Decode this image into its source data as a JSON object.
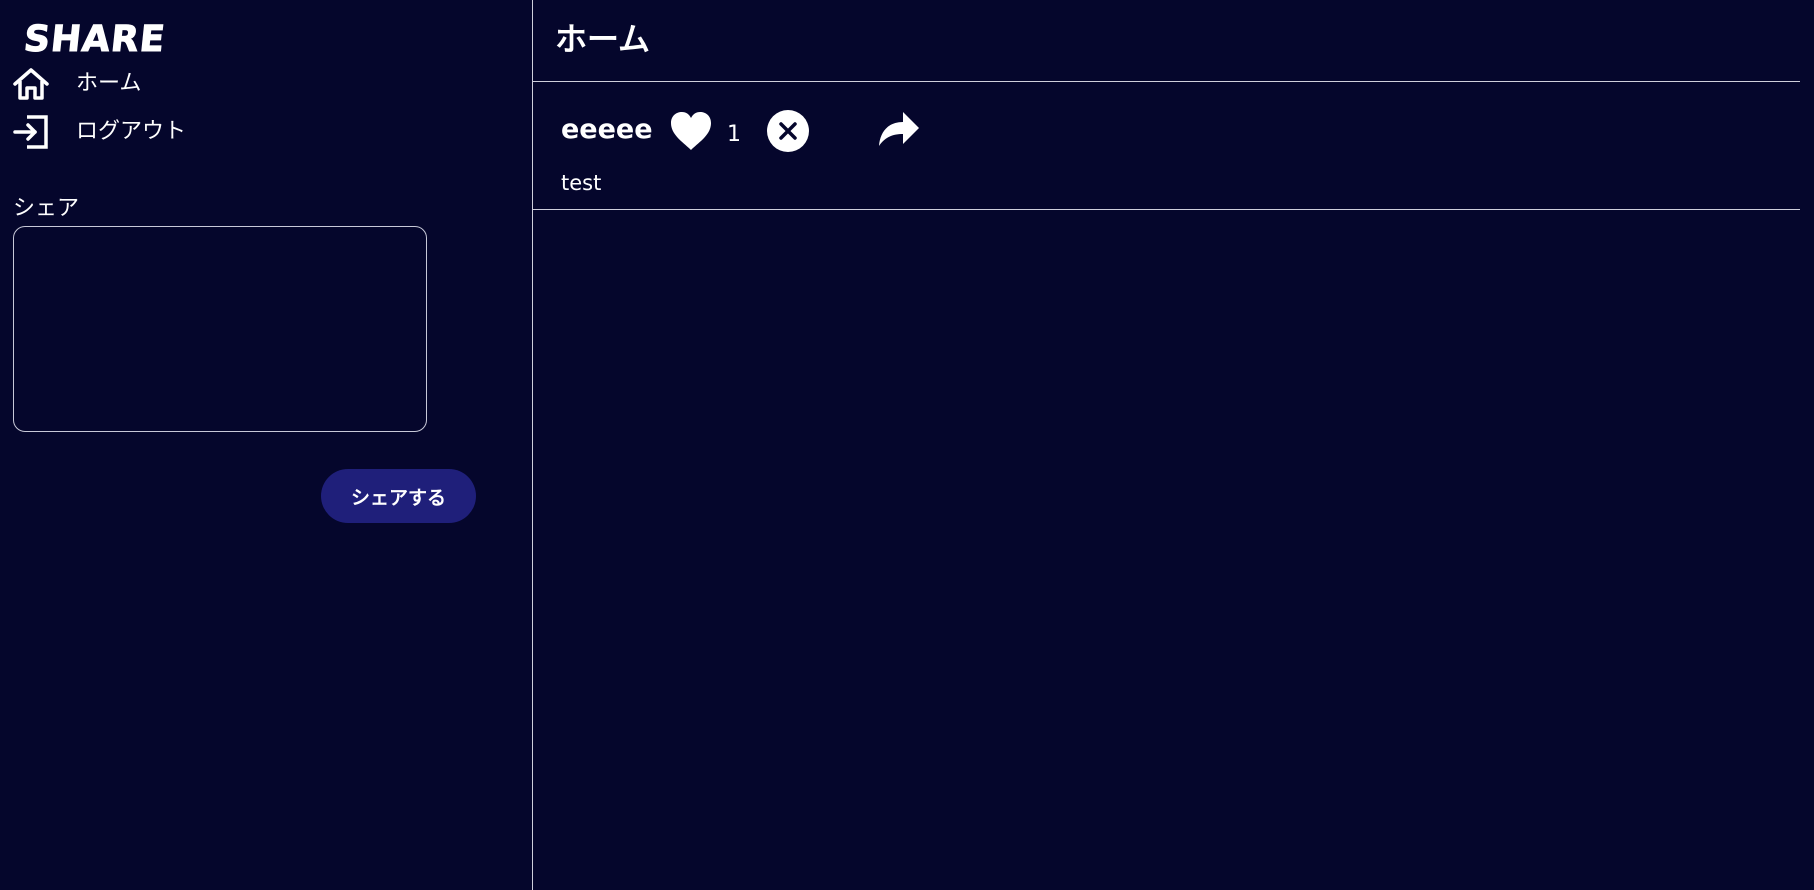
{
  "app": {
    "logo": "SHARE"
  },
  "sidebar": {
    "nav": [
      {
        "label": "ホーム",
        "icon": "home-icon"
      },
      {
        "label": "ログアウト",
        "icon": "logout-icon"
      }
    ],
    "share_label": "シェア",
    "share_placeholder": "",
    "share_button_label": "シェアする"
  },
  "main": {
    "title": "ホーム",
    "posts": [
      {
        "username": "eeeee",
        "likes": "1",
        "text": "test"
      }
    ]
  },
  "colors": {
    "background": "#05062c",
    "button": "#1f1f7a",
    "border": "#cfcfdc",
    "text": "#ffffff"
  }
}
